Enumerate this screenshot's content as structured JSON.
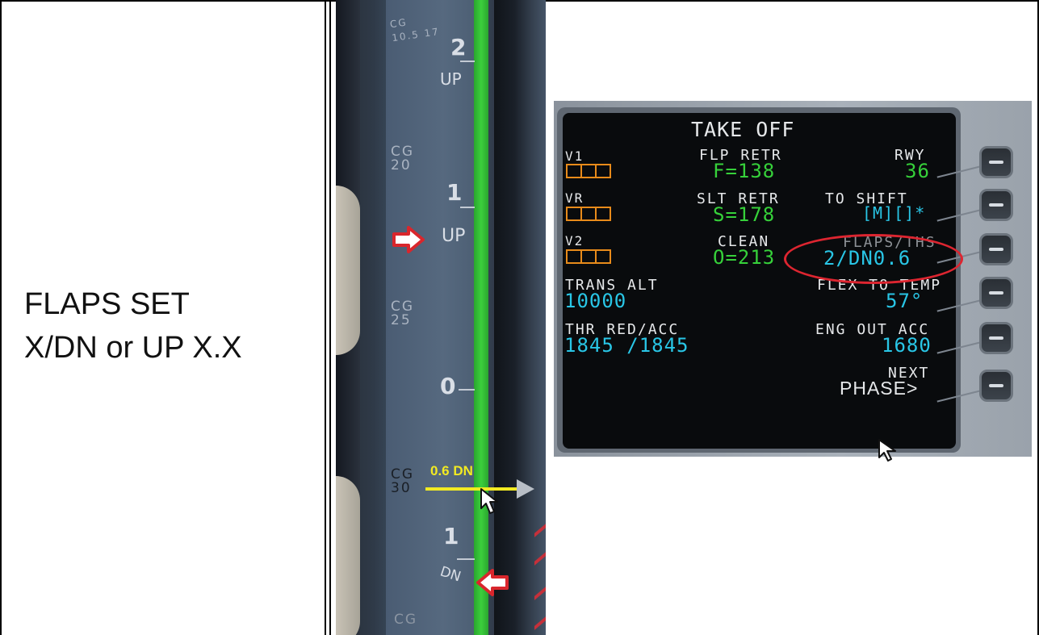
{
  "left_cell": {
    "line1": "FLAPS SET",
    "line2": "X/DN or UP X.X"
  },
  "trim_scale": {
    "cg_labels": [
      "CG 10.5 17",
      "CG 20",
      "CG 25",
      "CG 30",
      "CG"
    ],
    "marks": [
      {
        "num": "2",
        "word": "UP"
      },
      {
        "num": "1",
        "word": "UP"
      },
      {
        "num": "0",
        "word": ""
      },
      {
        "num": "1",
        "word": "DN"
      }
    ],
    "annotation": "0.6 DN",
    "colors": {
      "highlight": "#f2ea22",
      "arrow": "#d9262c",
      "trim_bar": "#36c836"
    }
  },
  "mcdu": {
    "title": "TAKE OFF",
    "v1_label": "V1",
    "vr_label": "VR",
    "v2_label": "V2",
    "flp_retr_label": "FLP RETR",
    "flp_retr_value": "F=138",
    "slt_retr_label": "SLT RETR",
    "slt_retr_value": "S=178",
    "clean_label": "CLEAN",
    "clean_value": "O=213",
    "rwy_label": "RWY",
    "rwy_value": "36",
    "to_shift_label": "TO SHIFT",
    "to_shift_value": "[M][]*",
    "flaps_ths_label": "FLAPS/THS",
    "flaps_ths_value": "2/DN0.6",
    "trans_alt_label": "TRANS ALT",
    "trans_alt_value": "10000",
    "flex_to_temp_label": "FLEX TO TEMP",
    "flex_to_temp_value": "57°",
    "thr_red_acc_label": "THR RED/ACC",
    "thr_red_acc_value": "1845 /1845",
    "eng_out_acc_label": "ENG OUT ACC",
    "eng_out_acc_value": "1680",
    "next_label": "NEXT",
    "phase_label": "PHASE>",
    "colors": {
      "label": "#e6e8ea",
      "green": "#36d13a",
      "cyan": "#29c6e6",
      "amber": "#e88b1a",
      "highlight": "#dd2530"
    }
  }
}
